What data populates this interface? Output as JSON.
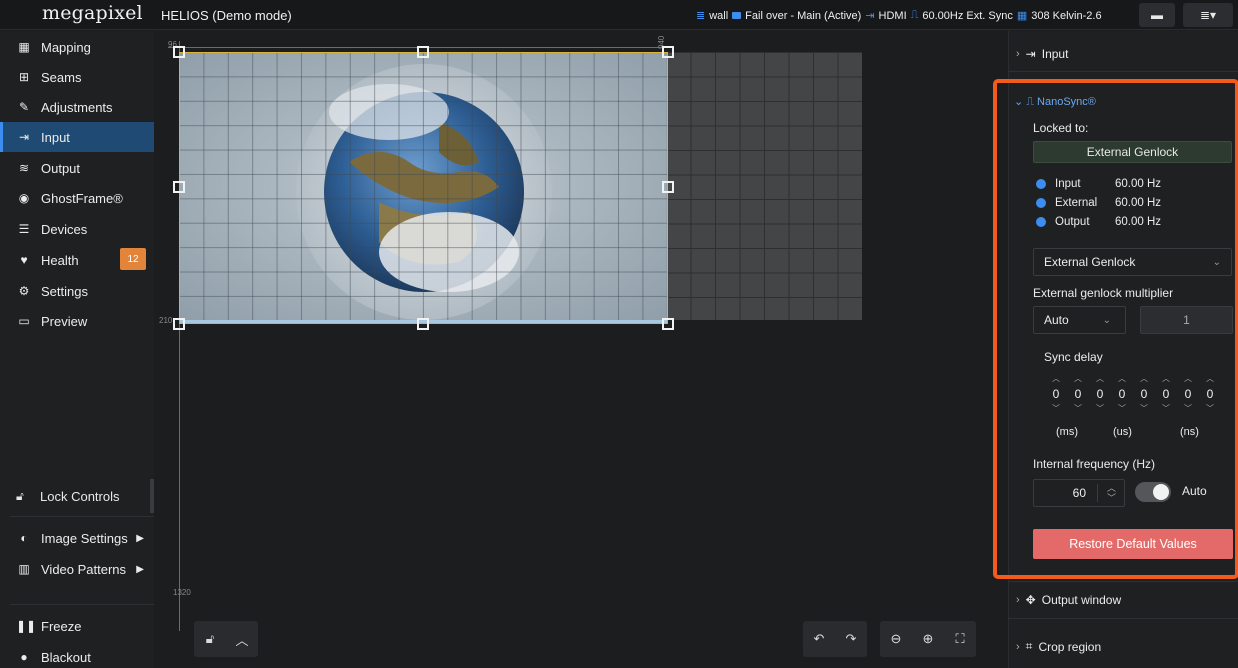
{
  "topbar": {
    "logo": "megapixel",
    "title": "HELIOS (Demo mode)",
    "status_wall": "wall",
    "status_failover": "Fail over - Main (Active)",
    "status_input": "HDMI",
    "status_sync": "60.00Hz Ext. Sync",
    "status_kelvin": "308 Kelvin-2.6"
  },
  "sidebar": {
    "items": [
      {
        "label": "Mapping",
        "icon": "grid-icon"
      },
      {
        "label": "Seams",
        "icon": "seams-icon"
      },
      {
        "label": "Adjustments",
        "icon": "brush-icon"
      },
      {
        "label": "Input",
        "icon": "input-icon"
      },
      {
        "label": "Output",
        "icon": "output-icon"
      },
      {
        "label": "GhostFrame®",
        "icon": "ghostframe-icon"
      },
      {
        "label": "Devices",
        "icon": "list-icon"
      },
      {
        "label": "Health",
        "icon": "heart-icon"
      },
      {
        "label": "Settings",
        "icon": "gears-icon"
      },
      {
        "label": "Preview",
        "icon": "monitor-icon"
      }
    ],
    "health_badge": "12",
    "lock_controls": "Lock Controls",
    "image_settings": "Image Settings",
    "video_patterns": "Video Patterns",
    "freeze": "Freeze",
    "blackout": "Blackout"
  },
  "canvas": {
    "ruler_top_left": "96",
    "ruler_top_right": "940",
    "ruler_left_mid": "210",
    "ruler_left_bottom": "1320"
  },
  "right_panel": {
    "input_section": "Input",
    "nanosync_title": "NanoSync®",
    "locked_to_label": "Locked to:",
    "locked_to_value": "External Genlock",
    "rates": [
      {
        "name": "Input",
        "value": "60.00 Hz"
      },
      {
        "name": "External",
        "value": "60.00 Hz"
      },
      {
        "name": "Output",
        "value": "60.00 Hz"
      }
    ],
    "sync_source_selected": "External Genlock",
    "multiplier_label": "External genlock multiplier",
    "multiplier_mode": "Auto",
    "multiplier_value": "1",
    "sync_delay_label": "Sync delay",
    "sync_delay_digits": [
      "0",
      "0",
      "0",
      "0",
      "0",
      "0",
      "0",
      "0"
    ],
    "unit_ms": "(ms)",
    "unit_us": "(us)",
    "unit_ns": "(ns)",
    "internal_freq_label": "Internal frequency (Hz)",
    "internal_freq_value": "60",
    "auto_label": "Auto",
    "restore_button": "Restore Default Values",
    "output_window": "Output window",
    "crop_region": "Crop region"
  }
}
